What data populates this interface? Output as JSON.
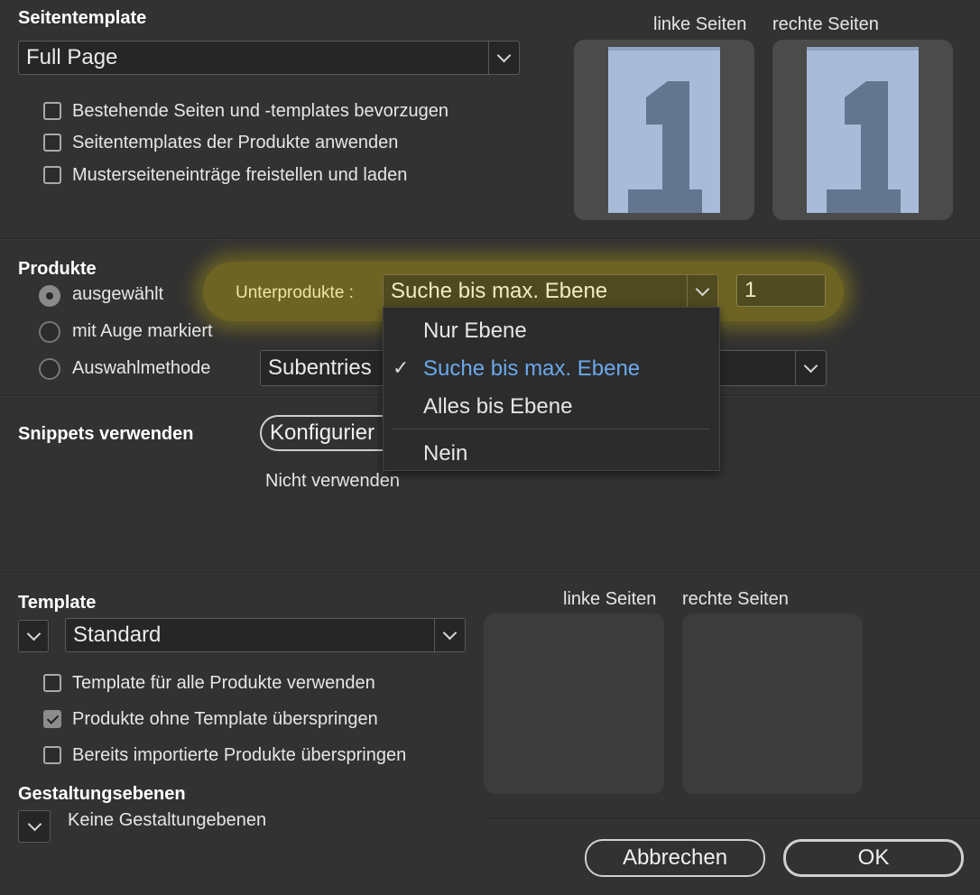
{
  "page_template": {
    "title": "Seitentemplate",
    "selected": "Full Page",
    "checkboxes": [
      {
        "label": "Bestehende Seiten und -templates bevorzugen",
        "checked": false
      },
      {
        "label": "Seitentemplates der Produkte anwenden",
        "checked": false
      },
      {
        "label": "Musterseiteneinträge freistellen und laden",
        "checked": false
      }
    ],
    "left_pages_label": "linke Seiten",
    "right_pages_label": "rechte Seiten",
    "page_number": "1"
  },
  "products": {
    "title": "Produkte",
    "radios": [
      {
        "label": "ausgewählt",
        "selected": true
      },
      {
        "label": "mit Auge markiert",
        "selected": false
      },
      {
        "label": "Auswahlmethode",
        "selected": false
      }
    ],
    "subproducts_label": "Unterprodukte :",
    "subproducts_value": "Suche bis max. Ebene",
    "level_value": "1",
    "method_value": "Subentries",
    "highlight_color": "#6d6423"
  },
  "dropdown": {
    "items": [
      {
        "label": "Nur Ebene",
        "checked": false
      },
      {
        "label": "Suche bis max. Ebene",
        "checked": true
      },
      {
        "label": "Alles bis Ebene",
        "checked": false
      },
      {
        "label": "Nein",
        "checked": false
      }
    ],
    "check_glyph": "✓",
    "active_color": "#6aa9ec"
  },
  "snippets": {
    "title": "Snippets verwenden",
    "configure_label": "Konfigurier",
    "status": "Nicht verwenden"
  },
  "template": {
    "title": "Template",
    "selected": "Standard",
    "checkboxes": [
      {
        "label": "Template für alle Produkte verwenden",
        "checked": false
      },
      {
        "label": "Produkte ohne Template überspringen",
        "checked": true
      },
      {
        "label": "Bereits importierte Produkte überspringen",
        "checked": false
      }
    ],
    "left_pages_label": "linke Seiten",
    "right_pages_label": "rechte Seiten"
  },
  "design_layers": {
    "title": "Gestaltungsebenen",
    "value": "Keine Gestaltungebenen"
  },
  "buttons": {
    "cancel": "Abbrechen",
    "ok": "OK"
  }
}
